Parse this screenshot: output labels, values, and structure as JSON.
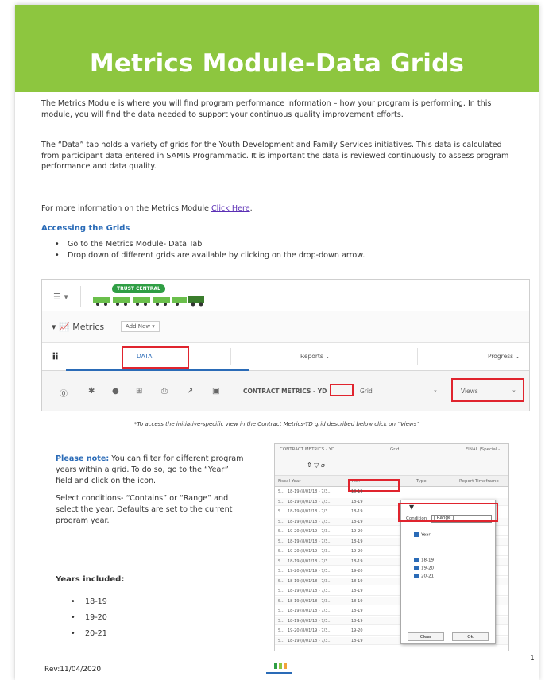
{
  "banner": {
    "title": "Metrics Module-Data Grids"
  },
  "paragraphs": {
    "p1": "The Metrics Module is where you will find program performance information – how your program is performing. In this module, you will find the data needed to support your continuous quality improvement efforts.",
    "p2": "The “Data” tab holds a variety of grids for the Youth Development and Family Services initiatives. This data is calculated from participant data entered in SAMIS Programmatic. It is important the data is reviewed continuously to assess program performance and data quality.",
    "p3_prefix": "For more information on the Metrics Module ",
    "p3_link": "Click Here",
    "p3_suffix": "."
  },
  "accessing": {
    "heading": "Accessing the Grids",
    "bullets": [
      "Go to the Metrics Module- Data Tab",
      "Drop down of different grids are available by clicking on the drop-down arrow."
    ]
  },
  "shot1": {
    "trust_badge": "TRUST CENTRAL",
    "metrics_label": "Metrics",
    "add_new": "Add New ▾",
    "tabs": {
      "data": "DATA",
      "reports": "Reports ⌄",
      "progress": "Progress ⌄"
    },
    "contract": "CONTRACT METRICS - YD",
    "grid": "Grid",
    "views": "Views"
  },
  "caption": "*To access the initiative-specific view in the Contract Metrics-YD grid described below click on “Views”",
  "note": {
    "strong": "Please note:",
    "text1": " You can filter for different program years within a grid. To do so, go to the “Year” field and click on the icon.",
    "text2": "Select conditions- “Contains” or “Range” and select the year. Defaults are set to the current program year.",
    "years_label": "Years included:",
    "years": [
      "18-19",
      "19-20",
      "20-21"
    ]
  },
  "shot2": {
    "top_contract": "CONTRACT METRICS - YD",
    "top_grid": "Grid",
    "top_final": "FINAL (Special -",
    "headers": [
      "Fiscal Year",
      "Year",
      "Type",
      "Report Timeframe"
    ],
    "rows": [
      [
        "18-19 (8/01/18 - 7/3...",
        "18-19"
      ],
      [
        "18-19 (8/01/18 - 7/3...",
        "18-19"
      ],
      [
        "18-19 (8/01/18 - 7/3...",
        "18-19"
      ],
      [
        "18-19 (8/01/18 - 7/3...",
        "18-19"
      ],
      [
        "19-20 (8/01/19 - 7/3...",
        "19-20"
      ],
      [
        "18-19 (8/01/18 - 7/3...",
        "18-19"
      ],
      [
        "19-20 (8/01/19 - 7/3...",
        "19-20"
      ],
      [
        "18-19 (8/01/18 - 7/3...",
        "18-19"
      ],
      [
        "19-20 (8/01/19 - 7/3...",
        "19-20"
      ],
      [
        "18-19 (8/01/18 - 7/3...",
        "18-19"
      ],
      [
        "18-19 (8/01/18 - 7/3...",
        "18-19"
      ],
      [
        "18-19 (8/01/18 - 7/3...",
        "18-19"
      ],
      [
        "18-19 (8/01/18 - 7/3...",
        "18-19"
      ],
      [
        "18-19 (8/01/18 - 7/3...",
        "18-19"
      ],
      [
        "19-20 (8/01/19 - 7/3...",
        "19-20"
      ],
      [
        "18-19 (8/01/18 - 7/3...",
        "18-19"
      ]
    ],
    "condition_label": "Condition",
    "condition_value": "[ Range ]",
    "checks": [
      "Year",
      "18-19",
      "19-20",
      "20-21"
    ],
    "clear": "Clear",
    "ok": "Ok"
  },
  "footer": {
    "page": "1",
    "rev": "Rev:11/04/2020"
  },
  "colors": {
    "banner": "#8dc63f",
    "accent": "#2a6bb7",
    "highlight": "#e0242e"
  }
}
